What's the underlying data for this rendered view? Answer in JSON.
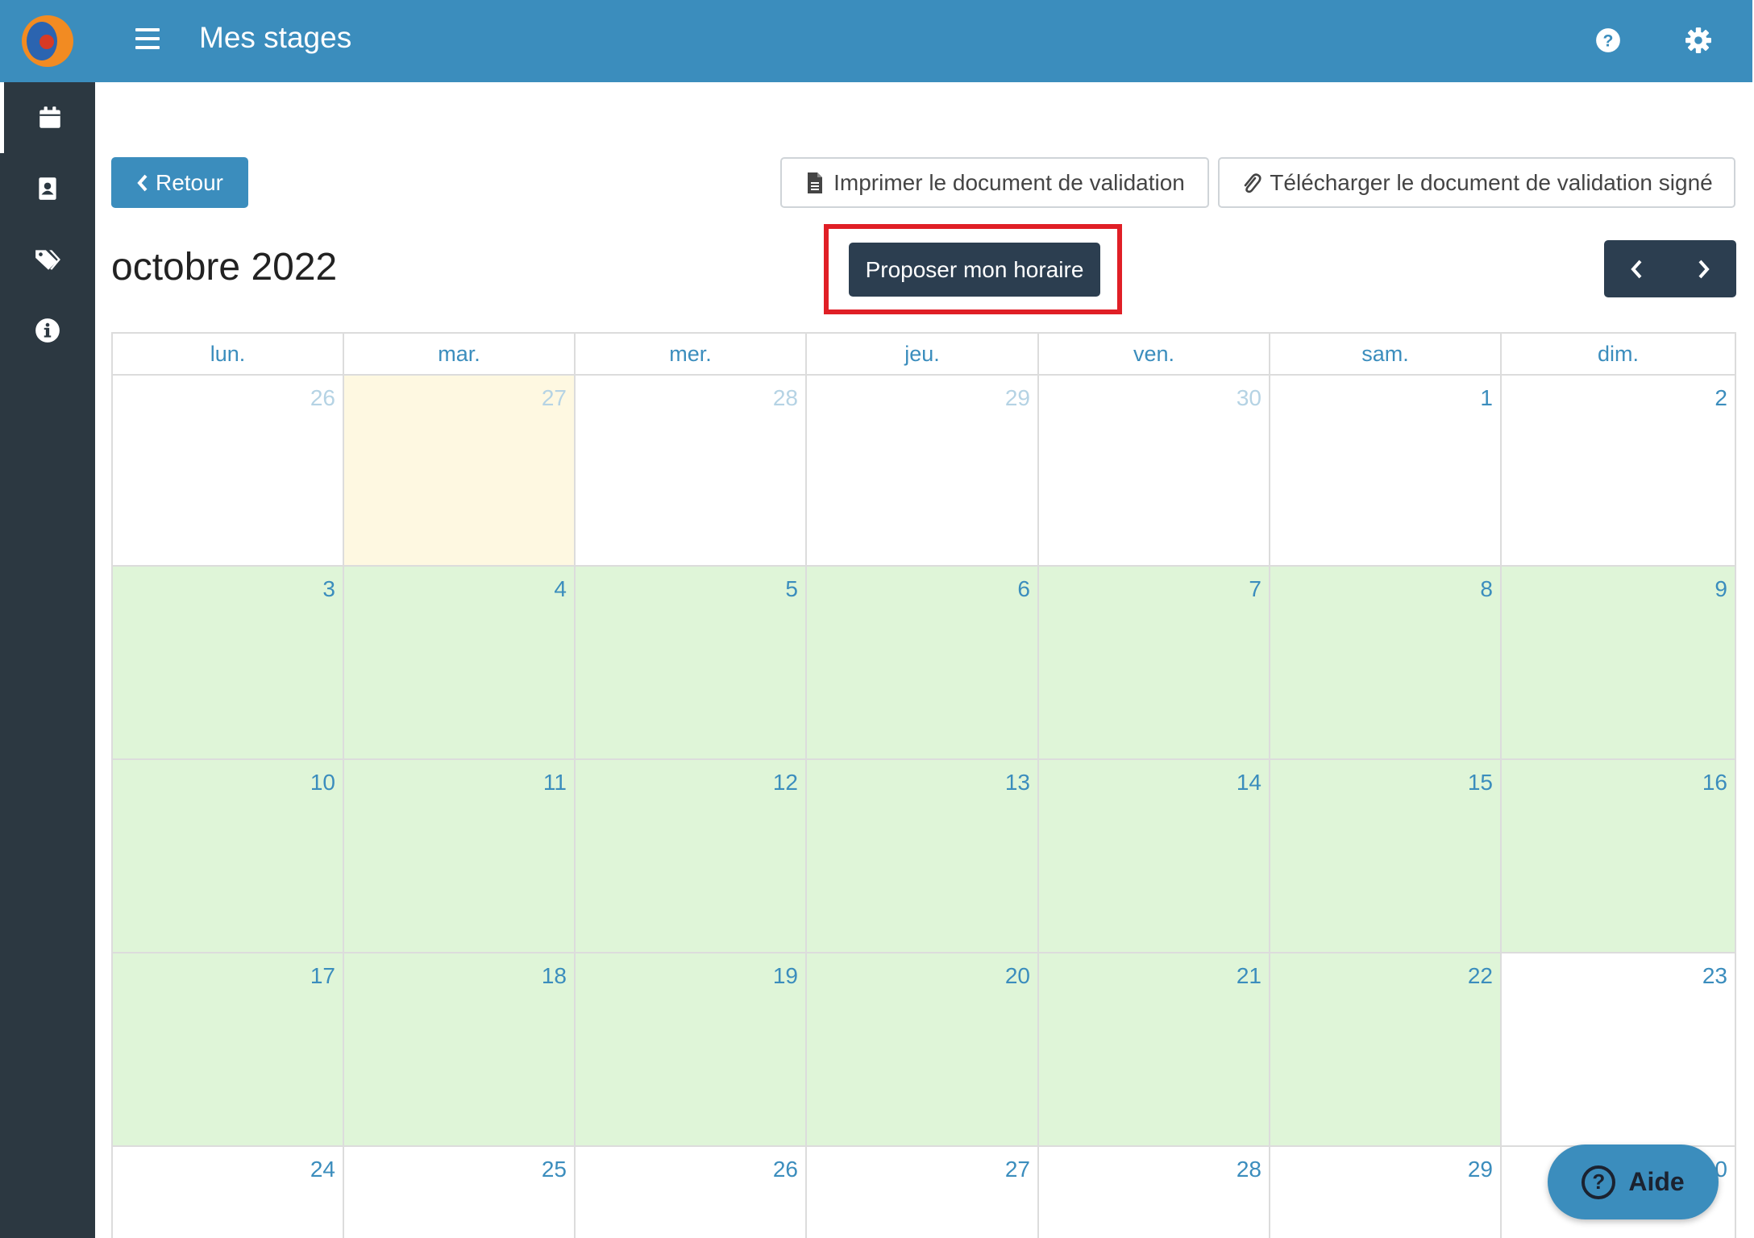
{
  "app": {
    "title": "Mes stages",
    "logo": "app-logo"
  },
  "sidebar": {
    "items": [
      {
        "icon": "calendar-icon",
        "active": true
      },
      {
        "icon": "contact-card-icon",
        "active": false
      },
      {
        "icon": "tags-icon",
        "active": false
      },
      {
        "icon": "info-icon",
        "active": false
      }
    ]
  },
  "topbar": {
    "icons": [
      "menu-icon",
      "help-icon",
      "gear-icon"
    ]
  },
  "toolbar": {
    "back_label": "Retour",
    "print_label": "Imprimer le document de validation",
    "download_label": "Télécharger le document de validation signé"
  },
  "calendar": {
    "month_title": "octobre 2022",
    "propose_label": "Proposer mon horaire",
    "prev_icon": "chevron-left-icon",
    "next_icon": "chevron-right-icon",
    "weekdays": [
      "lun.",
      "mar.",
      "mer.",
      "jeu.",
      "ven.",
      "sam.",
      "dim."
    ],
    "weeks": [
      [
        {
          "d": "26",
          "o": true,
          "bg": "white"
        },
        {
          "d": "27",
          "o": true,
          "bg": "today"
        },
        {
          "d": "28",
          "o": true,
          "bg": "white"
        },
        {
          "d": "29",
          "o": true,
          "bg": "white"
        },
        {
          "d": "30",
          "o": true,
          "bg": "white"
        },
        {
          "d": "1",
          "o": false,
          "bg": "white"
        },
        {
          "d": "2",
          "o": false,
          "bg": "white"
        }
      ],
      [
        {
          "d": "3",
          "o": false,
          "bg": "green"
        },
        {
          "d": "4",
          "o": false,
          "bg": "green"
        },
        {
          "d": "5",
          "o": false,
          "bg": "green"
        },
        {
          "d": "6",
          "o": false,
          "bg": "green"
        },
        {
          "d": "7",
          "o": false,
          "bg": "green"
        },
        {
          "d": "8",
          "o": false,
          "bg": "green"
        },
        {
          "d": "9",
          "o": false,
          "bg": "green"
        }
      ],
      [
        {
          "d": "10",
          "o": false,
          "bg": "green"
        },
        {
          "d": "11",
          "o": false,
          "bg": "green"
        },
        {
          "d": "12",
          "o": false,
          "bg": "green"
        },
        {
          "d": "13",
          "o": false,
          "bg": "green"
        },
        {
          "d": "14",
          "o": false,
          "bg": "green"
        },
        {
          "d": "15",
          "o": false,
          "bg": "green"
        },
        {
          "d": "16",
          "o": false,
          "bg": "green"
        }
      ],
      [
        {
          "d": "17",
          "o": false,
          "bg": "green"
        },
        {
          "d": "18",
          "o": false,
          "bg": "green"
        },
        {
          "d": "19",
          "o": false,
          "bg": "green"
        },
        {
          "d": "20",
          "o": false,
          "bg": "green"
        },
        {
          "d": "21",
          "o": false,
          "bg": "green"
        },
        {
          "d": "22",
          "o": false,
          "bg": "green"
        },
        {
          "d": "23",
          "o": false,
          "bg": "white"
        }
      ],
      [
        {
          "d": "24",
          "o": false,
          "bg": "white"
        },
        {
          "d": "25",
          "o": false,
          "bg": "white"
        },
        {
          "d": "26",
          "o": false,
          "bg": "white"
        },
        {
          "d": "27",
          "o": false,
          "bg": "white"
        },
        {
          "d": "28",
          "o": false,
          "bg": "white"
        },
        {
          "d": "29",
          "o": false,
          "bg": "white"
        },
        {
          "d": "30",
          "o": false,
          "bg": "white"
        }
      ]
    ]
  },
  "help_button": {
    "label": "Aide",
    "icon": "question-circle-icon"
  },
  "colors": {
    "primary": "#3b8dbd",
    "dark": "#2c3e50",
    "sidebar": "#2c3841",
    "green_day": "#dff5d8",
    "today": "#fef8e1",
    "highlight": "#e01f26"
  }
}
